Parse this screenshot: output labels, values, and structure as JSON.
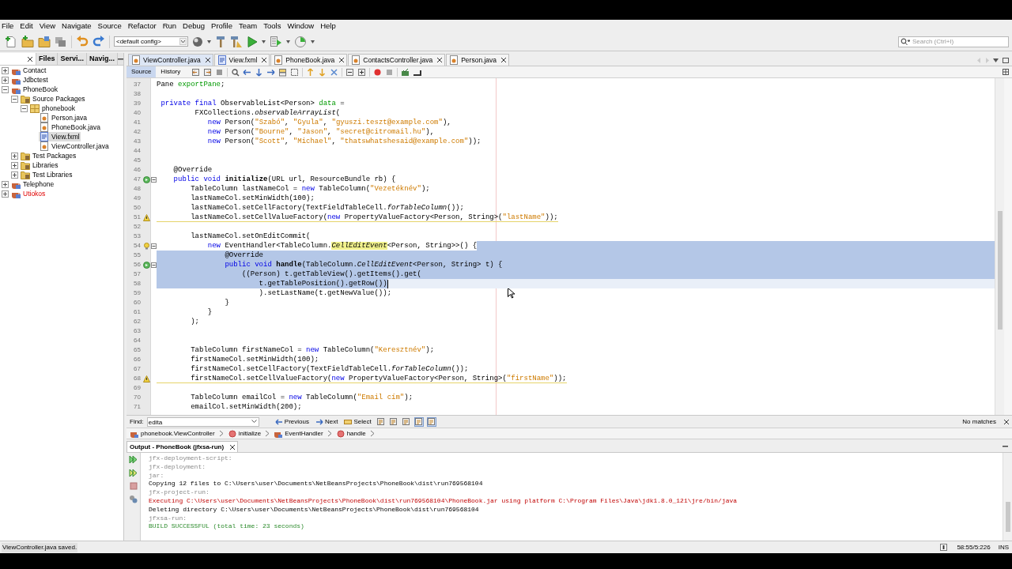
{
  "menu": [
    "File",
    "Edit",
    "View",
    "Navigate",
    "Source",
    "Refactor",
    "Run",
    "Debug",
    "Profile",
    "Team",
    "Tools",
    "Window",
    "Help"
  ],
  "toolbar": {
    "config": "<default config>",
    "search_placeholder": "Search (Ctrl+I)"
  },
  "panel_tabs": [
    {
      "label": "Files",
      "selected": false
    },
    {
      "label": "Servi...",
      "selected": false
    },
    {
      "label": "Navig...",
      "selected": false
    }
  ],
  "tree": [
    {
      "label": "Contact",
      "kind": "project",
      "expanded": false,
      "error": false,
      "selected": false
    },
    {
      "label": "Jdbctest",
      "kind": "project",
      "expanded": false,
      "error": false,
      "selected": false
    },
    {
      "label": "PhoneBook",
      "kind": "project",
      "expanded": true,
      "error": false,
      "selected": false,
      "children": [
        {
          "label": "Source Packages",
          "kind": "folder",
          "expanded": true,
          "selected": false,
          "children": [
            {
              "label": "phonebook",
              "kind": "package",
              "expanded": true,
              "selected": false,
              "children": [
                {
                  "label": "Person.java",
                  "kind": "java",
                  "selected": false
                },
                {
                  "label": "PhoneBook.java",
                  "kind": "java",
                  "selected": false
                },
                {
                  "label": "View.fxml",
                  "kind": "fxml",
                  "selected": true
                },
                {
                  "label": "ViewController.java",
                  "kind": "java",
                  "selected": false
                }
              ]
            }
          ]
        },
        {
          "label": "Test Packages",
          "kind": "folder",
          "expanded": false,
          "selected": false
        },
        {
          "label": "Libraries",
          "kind": "folder",
          "expanded": false,
          "selected": false
        },
        {
          "label": "Test Libraries",
          "kind": "folder",
          "expanded": false,
          "selected": false
        }
      ]
    },
    {
      "label": "Telephone",
      "kind": "project",
      "expanded": false,
      "error": false,
      "selected": false
    },
    {
      "label": "Utiokos",
      "kind": "project",
      "expanded": false,
      "error": true,
      "selected": false
    }
  ],
  "editor_tabs": [
    {
      "label": "ViewController.java",
      "kind": "java",
      "selected": true
    },
    {
      "label": "View.fxml",
      "kind": "fxml",
      "selected": false
    },
    {
      "label": "PhoneBook.java",
      "kind": "java",
      "selected": false
    },
    {
      "label": "ContactsController.java",
      "kind": "java",
      "selected": false
    },
    {
      "label": "Person.java",
      "kind": "java",
      "selected": false
    }
  ],
  "view_tabs": [
    {
      "label": "Source",
      "selected": true
    },
    {
      "label": "History",
      "selected": false
    }
  ],
  "code": [
    {
      "number": "37",
      "kind": "code",
      "fold": false,
      "selected": false,
      "current": false,
      "segments": [
        {
          "text": "Pane ",
          "kind": "plain"
        },
        {
          "text": "exportPane",
          "kind": "field"
        },
        {
          "text": ";",
          "kind": "plain"
        }
      ]
    },
    {
      "number": "38",
      "kind": "code",
      "fold": false,
      "selected": false,
      "current": false
    },
    {
      "number": "39",
      "kind": "code",
      "fold": false,
      "selected": false,
      "current": false,
      "segments": [
        {
          "text": " private final",
          "kind": "keyword"
        },
        {
          "text": " ObservableList<Person> ",
          "kind": "plain"
        },
        {
          "text": "data",
          "kind": "field"
        },
        {
          "text": " =",
          "kind": "plain"
        }
      ]
    },
    {
      "number": "40",
      "kind": "code",
      "fold": false,
      "selected": false,
      "current": false,
      "segments": [
        {
          "text": "         FXCollections.",
          "kind": "plain"
        },
        {
          "text": "observableArrayList",
          "kind": "italic"
        },
        {
          "text": "(",
          "kind": "plain"
        }
      ]
    },
    {
      "number": "41",
      "kind": "code",
      "fold": false,
      "selected": false,
      "current": false,
      "segments": [
        {
          "text": "            new",
          "kind": "keyword"
        },
        {
          "text": " Person(",
          "kind": "plain"
        },
        {
          "text": "\"Szabó\"",
          "kind": "string"
        },
        {
          "text": ", ",
          "kind": "plain"
        },
        {
          "text": "\"Gyula\"",
          "kind": "string"
        },
        {
          "text": ", ",
          "kind": "plain"
        },
        {
          "text": "\"gyuszi.teszt@example.com\"",
          "kind": "string"
        },
        {
          "text": "),",
          "kind": "plain"
        }
      ]
    },
    {
      "number": "42",
      "kind": "code",
      "fold": false,
      "selected": false,
      "current": false,
      "segments": [
        {
          "text": "            new",
          "kind": "keyword"
        },
        {
          "text": " Person(",
          "kind": "plain"
        },
        {
          "text": "\"Bourne\"",
          "kind": "string"
        },
        {
          "text": ", ",
          "kind": "plain"
        },
        {
          "text": "\"Jason\"",
          "kind": "string"
        },
        {
          "text": ", ",
          "kind": "plain"
        },
        {
          "text": "\"secret@citromail.hu\"",
          "kind": "string"
        },
        {
          "text": "),",
          "kind": "plain"
        }
      ]
    },
    {
      "number": "43",
      "kind": "code",
      "fold": false,
      "selected": false,
      "current": false,
      "segments": [
        {
          "text": "            new",
          "kind": "keyword"
        },
        {
          "text": " Person(",
          "kind": "plain"
        },
        {
          "text": "\"Scott\"",
          "kind": "string"
        },
        {
          "text": ", ",
          "kind": "plain"
        },
        {
          "text": "\"Michael\"",
          "kind": "string"
        },
        {
          "text": ", ",
          "kind": "plain"
        },
        {
          "text": "\"thatswhatshesaid@example.com\"",
          "kind": "string"
        },
        {
          "text": "));",
          "kind": "plain"
        }
      ]
    },
    {
      "number": "44",
      "kind": "code",
      "fold": false,
      "selected": false,
      "current": false
    },
    {
      "number": "45",
      "kind": "code",
      "fold": false,
      "selected": false,
      "current": false
    },
    {
      "number": "46",
      "kind": "code",
      "fold": false,
      "selected": false,
      "current": false,
      "segments": [
        {
          "text": "    @Override",
          "kind": "plain"
        }
      ]
    },
    {
      "number": "47",
      "kind": "override",
      "fold": true,
      "selected": false,
      "current": false,
      "segments": [
        {
          "text": "    public void ",
          "kind": "keyword"
        },
        {
          "text": "initialize",
          "kind": "method"
        },
        {
          "text": "(URL url, ResourceBundle rb) {",
          "kind": "plain"
        }
      ]
    },
    {
      "number": "48",
      "kind": "code",
      "fold": false,
      "selected": false,
      "current": false,
      "segments": [
        {
          "text": "        TableColumn lastNameCol = ",
          "kind": "plain"
        },
        {
          "text": "new",
          "kind": "keyword"
        },
        {
          "text": " TableColumn(",
          "kind": "plain"
        },
        {
          "text": "\"Vezetéknév\"",
          "kind": "string"
        },
        {
          "text": ");",
          "kind": "plain"
        }
      ]
    },
    {
      "number": "49",
      "kind": "code",
      "fold": false,
      "selected": false,
      "current": false,
      "segments": [
        {
          "text": "        lastNameCol.setMinWidth(100);",
          "kind": "plain"
        }
      ]
    },
    {
      "number": "50",
      "kind": "code",
      "fold": false,
      "selected": false,
      "current": false,
      "segments": [
        {
          "text": "        lastNameCol.setCellFactory(TextFieldTableCell.",
          "kind": "plain"
        },
        {
          "text": "forTableColumn",
          "kind": "italic"
        },
        {
          "text": "());",
          "kind": "plain"
        }
      ]
    },
    {
      "number": "51",
      "kind": "warning",
      "fold": false,
      "selected": false,
      "current": false,
      "segments": [
        {
          "text": "        lastNameCol.setCellValueFactory(",
          "kind": "plain"
        },
        {
          "text": "new",
          "kind": "keyword"
        },
        {
          "text": " PropertyValueFactory<Person, String>(",
          "kind": "plain"
        },
        {
          "text": "\"lastName\"",
          "kind": "string"
        },
        {
          "text": "));",
          "kind": "plain"
        }
      ]
    },
    {
      "number": "52",
      "kind": "code",
      "fold": false,
      "selected": false,
      "current": false
    },
    {
      "number": "53",
      "kind": "code",
      "fold": false,
      "selected": false,
      "current": false,
      "segments": [
        {
          "text": "        lastNameCol.setOnEditCommit(",
          "kind": "plain"
        }
      ]
    },
    {
      "number": "54",
      "kind": "hint",
      "fold": true,
      "selected": true,
      "current": false,
      "segments": [
        {
          "text": "            new",
          "kind": "keyword"
        },
        {
          "text": " EventHandler<TableColumn.",
          "kind": "plain"
        },
        {
          "text": "CellEditEvent",
          "kind": "highlight"
        },
        {
          "text": "<Person, String>>() {",
          "kind": "plain"
        }
      ]
    },
    {
      "number": "55",
      "kind": "code",
      "fold": false,
      "selected": true,
      "current": false,
      "segments": [
        {
          "text": "                @Override",
          "kind": "plain"
        }
      ]
    },
    {
      "number": "56",
      "kind": "override",
      "fold": true,
      "selected": true,
      "current": false,
      "segments": [
        {
          "text": "                public void ",
          "kind": "keyword"
        },
        {
          "text": "handle",
          "kind": "method"
        },
        {
          "text": "(TableColumn.",
          "kind": "plain"
        },
        {
          "text": "CellEditEvent",
          "kind": "italic"
        },
        {
          "text": "<Person, String> t) {",
          "kind": "plain"
        }
      ]
    },
    {
      "number": "57",
      "kind": "code",
      "fold": false,
      "selected": true,
      "current": false,
      "segments": [
        {
          "text": "                    ((Person) t.getTableView().getItems().get(",
          "kind": "plain"
        }
      ]
    },
    {
      "number": "58",
      "kind": "code",
      "fold": false,
      "selected": true,
      "current": true,
      "segments": [
        {
          "text": "                        t.getTablePosition().getRow())",
          "kind": "plain"
        }
      ]
    },
    {
      "number": "59",
      "kind": "code",
      "fold": false,
      "selected": false,
      "current": false,
      "segments": [
        {
          "text": "                        ).setLastName(t.getNewValue());",
          "kind": "plain"
        }
      ]
    },
    {
      "number": "60",
      "kind": "code",
      "fold": false,
      "selected": false,
      "current": false,
      "segments": [
        {
          "text": "                }",
          "kind": "plain"
        }
      ]
    },
    {
      "number": "61",
      "kind": "code",
      "fold": false,
      "selected": false,
      "current": false,
      "segments": [
        {
          "text": "            }",
          "kind": "plain"
        }
      ]
    },
    {
      "number": "62",
      "kind": "code",
      "fold": false,
      "selected": false,
      "current": false,
      "segments": [
        {
          "text": "        );",
          "kind": "plain"
        }
      ]
    },
    {
      "number": "63",
      "kind": "code",
      "fold": false,
      "selected": false,
      "current": false
    },
    {
      "number": "64",
      "kind": "code",
      "fold": false,
      "selected": false,
      "current": false
    },
    {
      "number": "65",
      "kind": "code",
      "fold": false,
      "selected": false,
      "current": false,
      "segments": [
        {
          "text": "        TableColumn firstNameCol = ",
          "kind": "plain"
        },
        {
          "text": "new",
          "kind": "keyword"
        },
        {
          "text": " TableColumn(",
          "kind": "plain"
        },
        {
          "text": "\"Keresztnév\"",
          "kind": "string"
        },
        {
          "text": ");",
          "kind": "plain"
        }
      ]
    },
    {
      "number": "66",
      "kind": "code",
      "fold": false,
      "selected": false,
      "current": false,
      "segments": [
        {
          "text": "        firstNameCol.setMinWidth(100);",
          "kind": "plain"
        }
      ]
    },
    {
      "number": "67",
      "kind": "code",
      "fold": false,
      "selected": false,
      "current": false,
      "segments": [
        {
          "text": "        firstNameCol.setCellFactory(TextFieldTableCell.",
          "kind": "plain"
        },
        {
          "text": "forTableColumn",
          "kind": "italic"
        },
        {
          "text": "());",
          "kind": "plain"
        }
      ]
    },
    {
      "number": "68",
      "kind": "warning",
      "fold": false,
      "selected": false,
      "current": false,
      "segments": [
        {
          "text": "        firstNameCol.setCellValueFactory(",
          "kind": "plain"
        },
        {
          "text": "new",
          "kind": "keyword"
        },
        {
          "text": " PropertyValueFactory<Person, String>(",
          "kind": "plain"
        },
        {
          "text": "\"firstName\"",
          "kind": "string"
        },
        {
          "text": "));",
          "kind": "plain"
        }
      ]
    },
    {
      "number": "69",
      "kind": "code",
      "fold": false,
      "selected": false,
      "current": false
    },
    {
      "number": "70",
      "kind": "code",
      "fold": false,
      "selected": false,
      "current": false,
      "segments": [
        {
          "text": "        TableColumn emailCol = ",
          "kind": "plain"
        },
        {
          "text": "new",
          "kind": "keyword"
        },
        {
          "text": " TableColumn(",
          "kind": "plain"
        },
        {
          "text": "\"Email cím\"",
          "kind": "string"
        },
        {
          "text": ");",
          "kind": "plain"
        }
      ]
    },
    {
      "number": "71",
      "kind": "code",
      "fold": false,
      "selected": false,
      "current": false,
      "segments": [
        {
          "text": "        emailCol.setMinWidth(200);",
          "kind": "plain"
        }
      ]
    }
  ],
  "find": {
    "label": "Find:",
    "value": "edita",
    "buttons": [
      "Previous",
      "Next",
      "Select"
    ],
    "toggles": [
      {
        "on": false
      },
      {
        "on": false
      },
      {
        "on": false
      },
      {
        "on": true
      },
      {
        "on": true
      }
    ],
    "status": "No matches"
  },
  "breadcrumb": [
    {
      "label": "phonebook.ViewController",
      "kind": "class"
    },
    {
      "label": "initialize",
      "kind": "method"
    },
    {
      "label": "EventHandler",
      "kind": "class"
    },
    {
      "label": "handle",
      "kind": "method"
    }
  ],
  "output": {
    "title": "Output - PhoneBook (jfxsa-run)",
    "lines": [
      {
        "text": "jfx-deployment-script:",
        "kind": "target"
      },
      {
        "text": "jfx-deployment:",
        "kind": "target"
      },
      {
        "text": "jar:",
        "kind": "target"
      },
      {
        "text": "Copying 12 files to C:\\Users\\user\\Documents\\NetBeansProjects\\PhoneBook\\dist\\run769568104",
        "kind": "info"
      },
      {
        "text": "jfx-project-run:",
        "kind": "target"
      },
      {
        "text": "Executing C:\\Users\\user\\Documents\\NetBeansProjects\\PhoneBook\\dist\\run769568104\\PhoneBook.jar using platform C:\\Program Files\\Java\\jdk1.8.0_121\\jre/bin/java",
        "kind": "error"
      },
      {
        "text": "Deleting directory C:\\Users\\user\\Documents\\NetBeansProjects\\PhoneBook\\dist\\run769568104",
        "kind": "info"
      },
      {
        "text": "jfxsa-run:",
        "kind": "target"
      },
      {
        "text": "BUILD SUCCESSFUL (total time: 23 seconds)",
        "kind": "success"
      }
    ]
  },
  "status_bar": {
    "message": "ViewController.java saved.",
    "position": "58:55/5:226",
    "mode": "INS"
  }
}
